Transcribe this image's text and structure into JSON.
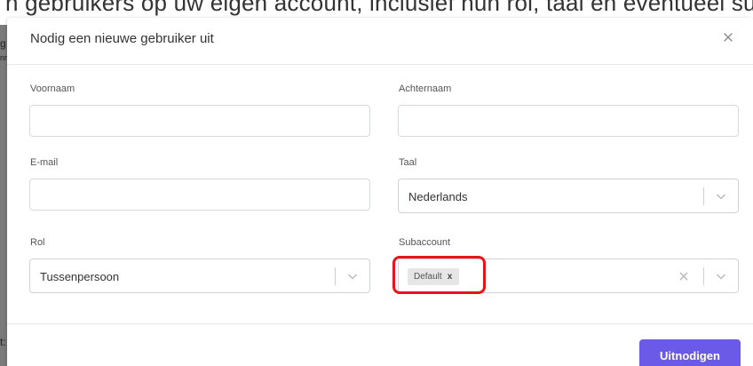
{
  "background": {
    "top_text": "n gebruikers op uw eigen account, inclusief hun rol, taal en eventueel subaccount ook",
    "left_fragments": [
      "g",
      "nr",
      "t:"
    ]
  },
  "modal": {
    "title": "Nodig een nieuwe gebruiker uit",
    "close_icon": "close-icon",
    "fields": {
      "first_name": {
        "label": "Voornaam",
        "value": ""
      },
      "last_name": {
        "label": "Achternaam",
        "value": ""
      },
      "email": {
        "label": "E-mail",
        "value": ""
      },
      "language": {
        "label": "Taal",
        "value": "Nederlands"
      },
      "role": {
        "label": "Rol",
        "value": "Tussenpersoon"
      },
      "subaccount": {
        "label": "Subaccount",
        "tag": "Default",
        "tag_remove": "x"
      }
    },
    "submit_label": "Uitnodigen"
  },
  "colors": {
    "accent": "#6b5ae8",
    "highlight": "#e8141c"
  }
}
